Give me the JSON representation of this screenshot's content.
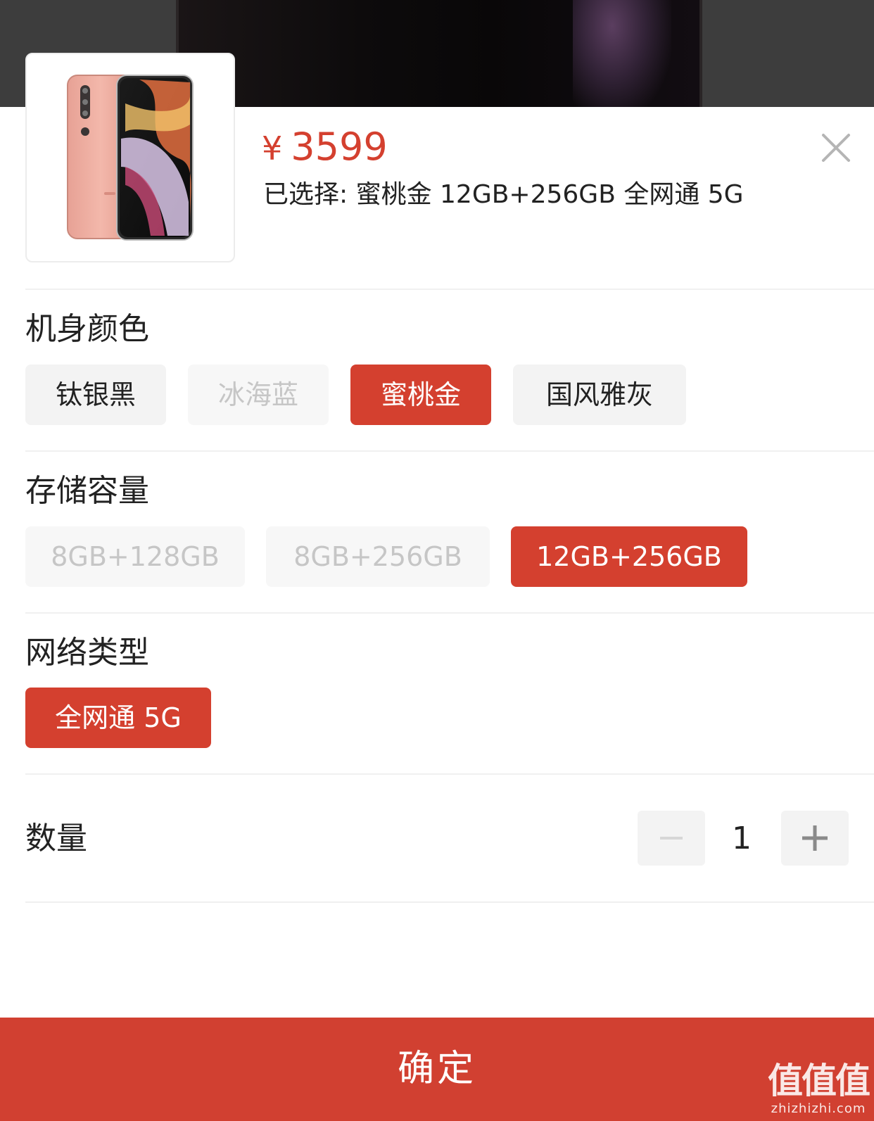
{
  "product": {
    "currency": "¥",
    "price": "3599",
    "selected_text": "已选择: 蜜桃金 12GB+256GB 全网通 5G"
  },
  "sections": {
    "color": {
      "title": "机身颜色",
      "options": [
        {
          "label": "钛银黑",
          "state": "normal"
        },
        {
          "label": "冰海蓝",
          "state": "disabled"
        },
        {
          "label": "蜜桃金",
          "state": "selected"
        },
        {
          "label": "国风雅灰",
          "state": "normal"
        }
      ]
    },
    "storage": {
      "title": "存储容量",
      "options": [
        {
          "label": "8GB+128GB",
          "state": "disabled"
        },
        {
          "label": "8GB+256GB",
          "state": "disabled"
        },
        {
          "label": "12GB+256GB",
          "state": "selected"
        }
      ]
    },
    "network": {
      "title": "网络类型",
      "options": [
        {
          "label": "全网通 5G",
          "state": "selected"
        }
      ]
    }
  },
  "quantity": {
    "label": "数量",
    "value": "1"
  },
  "confirm_label": "确定",
  "watermark": {
    "logo": "值值值",
    "url": "zhizhizhi.com"
  },
  "colors": {
    "accent": "#d4402f",
    "chip_bg": "#f3f3f3",
    "disabled_text": "#c6c6c6"
  },
  "icons": [
    "close-icon",
    "minus-icon",
    "plus-icon",
    "product-image"
  ]
}
